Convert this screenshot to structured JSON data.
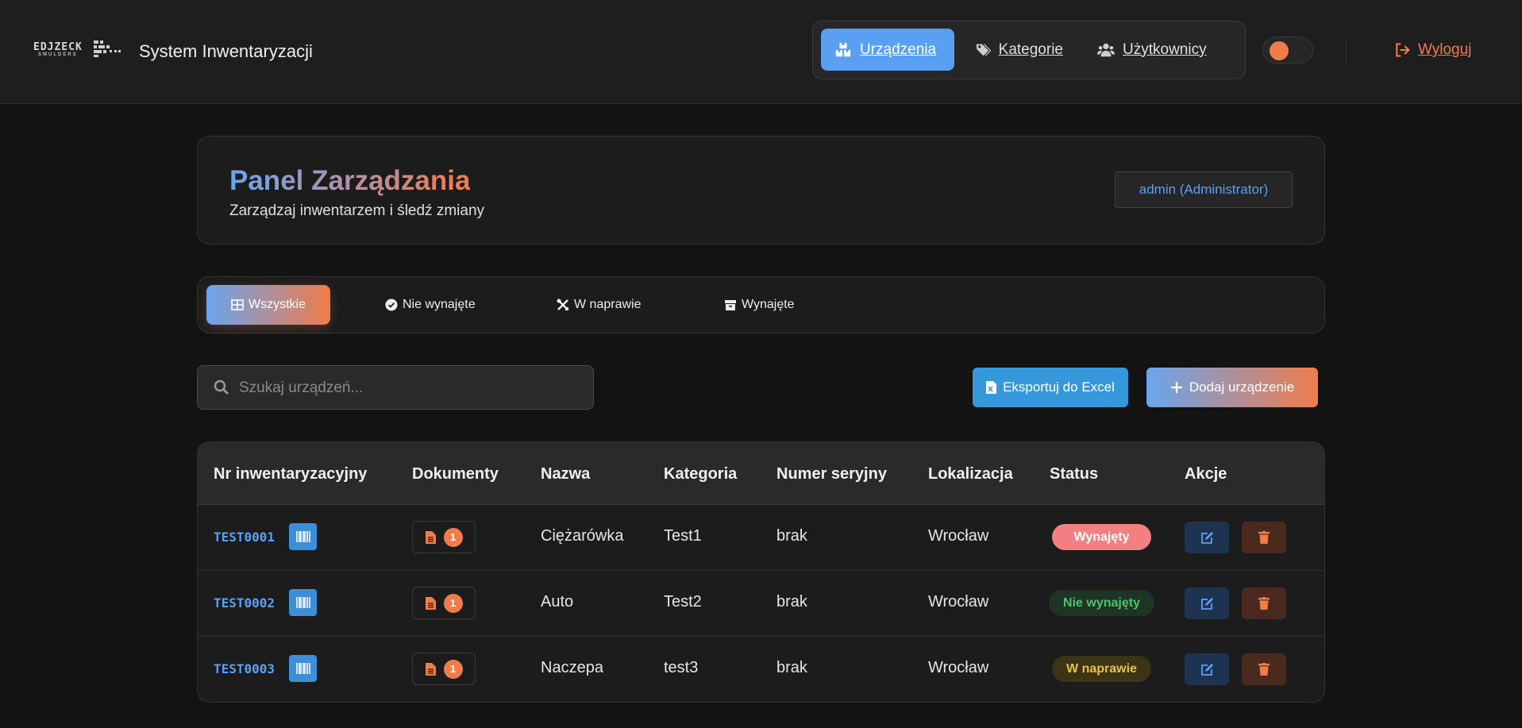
{
  "header": {
    "logo_text": "EDJZECK",
    "logo_sub": "SMULDERS",
    "app_title": "System Inwentaryzacji",
    "nav": [
      {
        "label": "Urządzenia",
        "icon": "boxes-icon",
        "active": true
      },
      {
        "label": "Kategorie",
        "icon": "tags-icon",
        "active": false
      },
      {
        "label": "Użytkownicy",
        "icon": "users-icon",
        "active": false
      }
    ],
    "logout_label": "Wyloguj"
  },
  "panel": {
    "title": "Panel Zarządzania",
    "subtitle": "Zarządzaj inwentarzem i śledź zmiany",
    "user": "admin (Administrator)"
  },
  "filters": [
    {
      "label": "Wszystkie",
      "icon": "grid-icon",
      "active": true
    },
    {
      "label": "Nie wynajęte",
      "icon": "check-circle-icon",
      "active": false
    },
    {
      "label": "W naprawie",
      "icon": "tools-icon",
      "active": false
    },
    {
      "label": "Wynajęte",
      "icon": "archive-icon",
      "active": false
    }
  ],
  "search": {
    "placeholder": "Szukaj urządzeń...",
    "value": ""
  },
  "actions": {
    "export_label": "Eksportuj do Excel",
    "add_label": "Dodaj urządzenie"
  },
  "table": {
    "columns": [
      "Nr inwentaryzacyjny",
      "Dokumenty",
      "Nazwa",
      "Kategoria",
      "Numer seryjny",
      "Lokalizacja",
      "Status",
      "Akcje"
    ],
    "rows": [
      {
        "inv": "TEST0001",
        "docs": "1",
        "name": "Ciężarówka",
        "category": "Test1",
        "serial": "brak",
        "location": "Wrocław",
        "status": "Wynajęty"
      },
      {
        "inv": "TEST0002",
        "docs": "1",
        "name": "Auto",
        "category": "Test2",
        "serial": "brak",
        "location": "Wrocław",
        "status": "Nie wynajęty"
      },
      {
        "inv": "TEST0003",
        "docs": "1",
        "name": "Naczepa",
        "category": "test3",
        "serial": "brak",
        "location": "Wrocław",
        "status": "W naprawie"
      }
    ]
  },
  "colors": {
    "accent_blue": "#5aa0f2",
    "accent_orange": "#f07c4a",
    "status_rented_bg": "#f28080",
    "status_available_text": "#4cc36a",
    "status_repair_text": "#e8c14a"
  }
}
